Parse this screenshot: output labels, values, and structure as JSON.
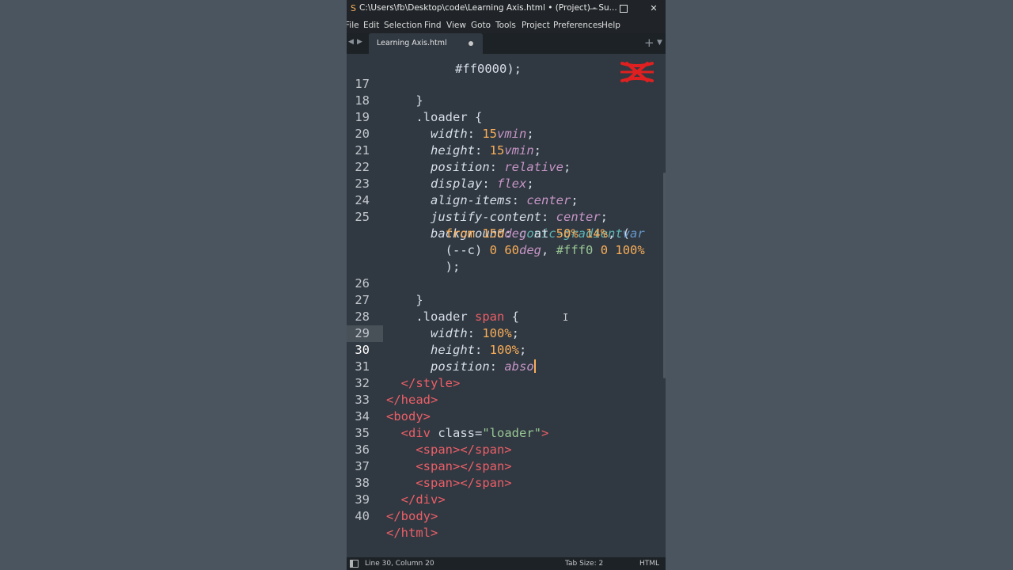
{
  "window": {
    "title": "C:\\Users\\fb\\Desktop\\code\\Learning Axis.html • (Project) - Su..."
  },
  "menu": [
    "File",
    "Edit",
    "Selection",
    "Find",
    "View",
    "Goto",
    "Tools",
    "Project",
    "Preferences",
    "Help"
  ],
  "tab": {
    "label": "Learning Axis.html"
  },
  "editor": {
    "line_numbers": [
      "17",
      "18",
      "19",
      "20",
      "21",
      "22",
      "23",
      "24",
      "25",
      "",
      "",
      "",
      "26",
      "27",
      "28",
      "29",
      "30",
      "31",
      "32",
      "33",
      "34",
      "35",
      "36",
      "37",
      "38",
      "39",
      "40"
    ],
    "current_line": "30",
    "partial_top_text": "#ff0000);"
  },
  "status": {
    "position": "Line 30, Column 20",
    "tab_size": "Tab Size: 2",
    "syntax": "HTML"
  },
  "colors": {
    "background": "#4b5560",
    "editor_bg": "#303841",
    "caret": "#f9ae58",
    "tag": "#ec5f67",
    "number": "#f9ae58",
    "keyword": "#c695c6",
    "function": "#5fb4b4",
    "string": "#99c794",
    "logo": "#e02020"
  }
}
